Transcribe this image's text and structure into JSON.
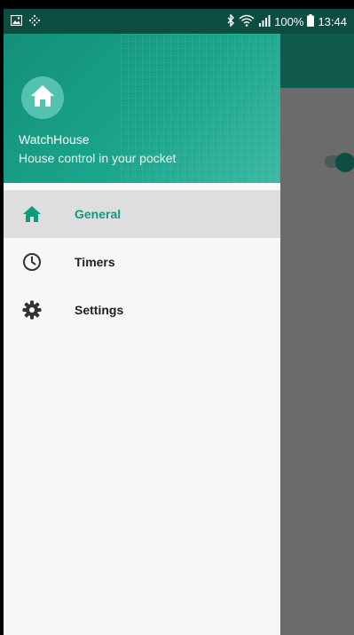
{
  "status_bar": {
    "left_icons": [
      "image-icon",
      "signal-dots-icon"
    ],
    "right_icons": [
      "bluetooth-icon",
      "wifi-icon",
      "cell-signal-icon",
      "battery-icon"
    ],
    "battery": "100%",
    "time": "13:44"
  },
  "drawer": {
    "header": {
      "icon": "home-icon",
      "title": "WatchHouse",
      "subtitle": "House control in your pocket"
    },
    "items": [
      {
        "label": "General",
        "icon": "home-icon",
        "active": true
      },
      {
        "label": "Timers",
        "icon": "clock-icon",
        "active": false
      },
      {
        "label": "Settings",
        "icon": "gear-icon",
        "active": false
      }
    ]
  },
  "colors": {
    "accent": "#109b80",
    "header_gradient_start": "#138f78",
    "app_bar": "#0f5a4d",
    "status_bar": "#0c4d41",
    "scrim": "#6b6b6b"
  }
}
